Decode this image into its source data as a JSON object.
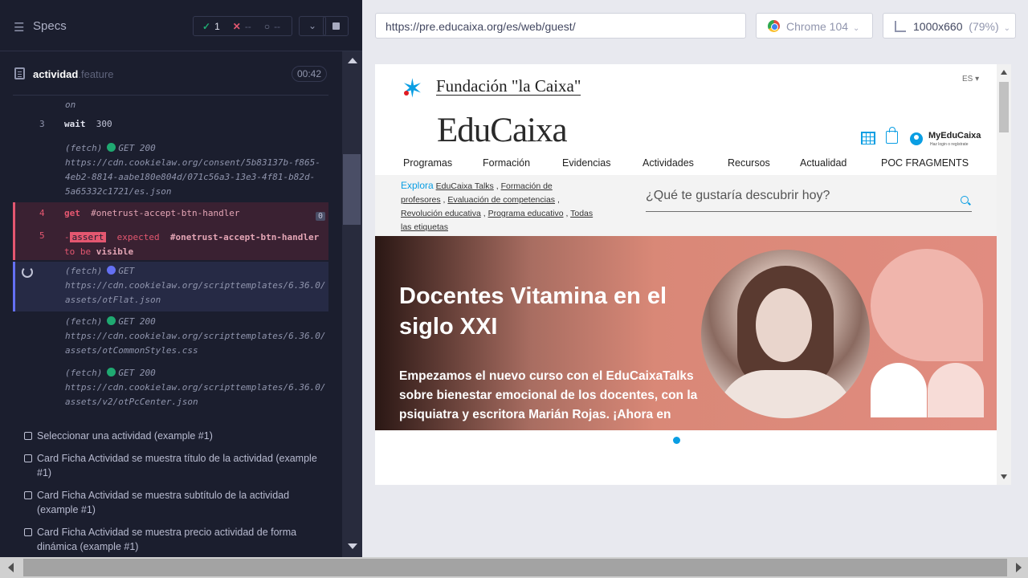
{
  "specs_panel": {
    "title": "Specs",
    "passed_count": "1",
    "failed_count": "--",
    "pending_count": "--"
  },
  "file": {
    "name": "actividad",
    "ext": ".feature",
    "duration": "00:42"
  },
  "commands": {
    "prev_tail": "on",
    "wait": {
      "num": "3",
      "name": "wait",
      "arg": "300"
    },
    "fetch1": {
      "label": "(fetch)",
      "status": "GET 200",
      "url_l1": "https://cdn.cookielaw.org/consent/5b83137b-f865-",
      "url_l2": "4eb2-8814-aabe180e804d/071c56a3-13e3-4f81-b82d-",
      "url_l3": "5a65332c1721/es.json"
    },
    "get": {
      "num": "4",
      "name": "get",
      "selector": "#onetrust-accept-btn-handler",
      "badge": "0"
    },
    "assert": {
      "num": "5",
      "dash": "-",
      "name": "assert",
      "expected": "expected",
      "selector": "#onetrust-accept-btn-handler",
      "to_be": "to be",
      "visible": "visible"
    },
    "fetch2": {
      "label": "(fetch)",
      "status": "GET",
      "url_l1": "https://cdn.cookielaw.org/scripttemplates/6.36.0/",
      "url_l2": "assets/otFlat.json"
    },
    "fetch3": {
      "label": "(fetch)",
      "status": "GET 200",
      "url_l1": "https://cdn.cookielaw.org/scripttemplates/6.36.0/",
      "url_l2": "assets/otCommonStyles.css"
    },
    "fetch4": {
      "label": "(fetch)",
      "status": "GET 200",
      "url_l1": "https://cdn.cookielaw.org/scripttemplates/6.36.0/",
      "url_l2": "assets/v2/otPcCenter.json"
    }
  },
  "tests": [
    "Seleccionar una actividad (example #1)",
    "Card Ficha Actividad se muestra título de la actividad (example #1)",
    "Card Ficha Actividad se muestra subtítulo de la actividad (example #1)",
    "Card Ficha Actividad se muestra precio actividad de forma dinámica (example #1)"
  ],
  "toolbar": {
    "url": "https://pre.educaixa.org/es/web/guest/",
    "browser": "Chrome 104",
    "viewport": "1000x660",
    "zoom": "(79%)"
  },
  "site": {
    "foundation": "Fundación \"la Caixa\"",
    "lang": "ES",
    "brand": "EduCaixa",
    "myedu": "MyEduCaixa",
    "myedu_sub": "Haz login o regístrate",
    "menu": [
      "Programas",
      "Formación",
      "Evidencias",
      "Actividades",
      "Recursos",
      "Actualidad",
      "POC FRAGMENTS"
    ],
    "explora": "Explora",
    "tags": [
      "EduCaixa Talks",
      "Formación de profesores",
      "Evaluación de competencias",
      "Revolución educativa",
      "Programa educativo",
      "Todas las etiquetas"
    ],
    "search_placeholder": "¿Qué te gustaría descubrir hoy?",
    "banner_title": "Docentes Vitamina en el siglo XXI",
    "banner_text": "Empezamos el nuevo curso con el EduCaixaTalks sobre bienestar emocional de los docentes, con la psiquiatra y escritora Marián Rojas. ¡Ahora en"
  },
  "colors": {
    "pass": "#1fa971",
    "fail": "#e45770",
    "pending": "#6470f3",
    "educaixa_blue": "#0a9ee3"
  }
}
